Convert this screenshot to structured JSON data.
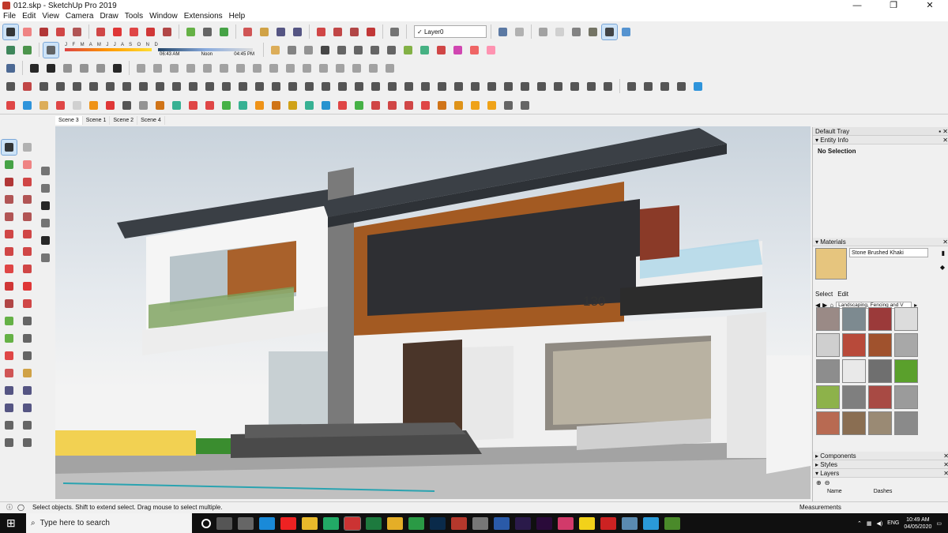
{
  "window": {
    "title": "012.skp - SketchUp Pro 2019"
  },
  "menu": [
    "File",
    "Edit",
    "View",
    "Camera",
    "Draw",
    "Tools",
    "Window",
    "Extensions",
    "Help"
  ],
  "layer": {
    "current": "Layer0",
    "check": "✓"
  },
  "shadows": {
    "months": "J F M A M J J A S O N D",
    "time_start": "06:43 AM",
    "time_mid": "Noon",
    "time_end": "04:45 PM"
  },
  "scenes": [
    "Scene 3",
    "Scene 1",
    "Scene 2",
    "Scene 4"
  ],
  "model": {
    "house_number": "130"
  },
  "tray": {
    "title": "Default Tray",
    "entity_info": {
      "label": "Entity Info",
      "selection": "No Selection"
    },
    "materials": {
      "label": "Materials",
      "current_name": "Stone Brushed Khaki",
      "tabs": [
        "Select",
        "Edit"
      ],
      "library": "Landscaping, Fencing and V",
      "swatch_colors": [
        "#9a8a86",
        "#7d8a90",
        "#9b3a3a",
        "#dcdcdc",
        "#cfcfcf",
        "#b84a3a",
        "#a0522d",
        "#a8a8a8",
        "#8d8d8d",
        "#e9e9e9",
        "#6f6f6f",
        "#5aa02c",
        "#8db24a",
        "#7f7f7f",
        "#a84a44",
        "#9b9b9b",
        "#b86a52",
        "#8a6e52",
        "#9a8a74",
        "#8a8a8a"
      ]
    },
    "components": "Components",
    "styles": "Styles",
    "layers": {
      "label": "Layers",
      "col_name": "Name",
      "col_dashes": "Dashes"
    }
  },
  "status": {
    "hint": "Select objects. Shift to extend select. Drag mouse to select multiple.",
    "measurements": "Measurements"
  },
  "taskbar": {
    "search_placeholder": "Type here to search",
    "lang": "ENG",
    "time": "10:49 AM",
    "date": "04/05/2020"
  },
  "colors": {
    "accent": "#cde3f7",
    "taskbar": "#101010"
  }
}
